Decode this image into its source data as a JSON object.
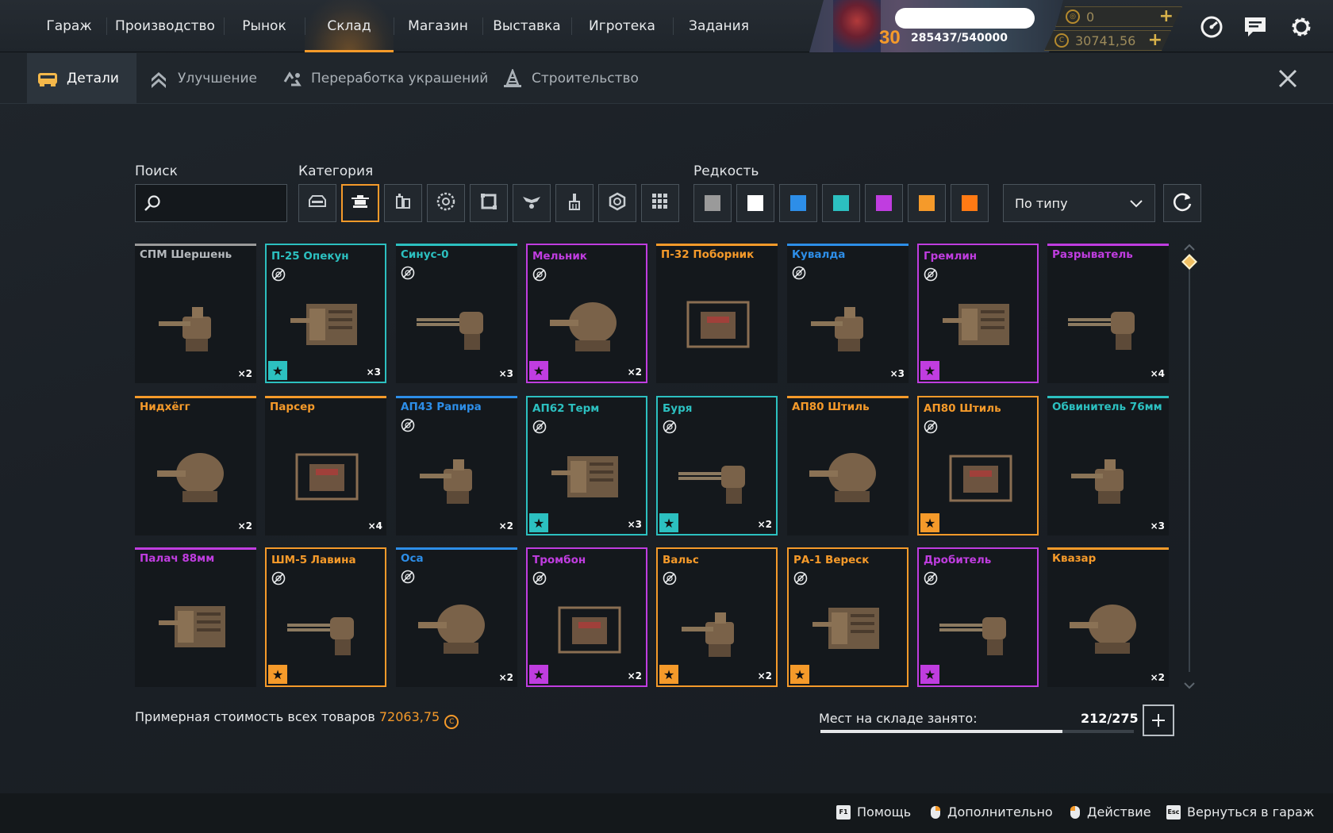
{
  "colors": {
    "accent": "#f59a2a",
    "rarity_common": "#9a9a9a",
    "rarity_rare": "#2d8ee8",
    "rarity_special": "#2cc0c0",
    "rarity_epic": "#c03de0",
    "rarity_legendary": "#f59a2a",
    "rarity_relic": "#ff7a14"
  },
  "nav": {
    "items": [
      "Гараж",
      "Производство",
      "Рынок",
      "Склад",
      "Магазин",
      "Выставка",
      "Игротека",
      "Задания"
    ],
    "active_index": 3
  },
  "profile": {
    "level": "30",
    "xp": "285437/540000",
    "currency_1": "0",
    "currency_2": "30741,56"
  },
  "top_icons": [
    "speedometer-icon",
    "chat-icon",
    "gear-icon"
  ],
  "subnav": {
    "items": [
      {
        "label": "Детали",
        "icon": "parts-icon"
      },
      {
        "label": "Улучшение",
        "icon": "upgrade-icon"
      },
      {
        "label": "Переработка украшений",
        "icon": "recycle-icon"
      },
      {
        "label": "Строительство",
        "icon": "construction-icon"
      }
    ],
    "active_index": 0
  },
  "filters": {
    "search_label": "Поиск",
    "search_value": "",
    "category_label": "Категория",
    "categories": [
      "cabin-icon",
      "weapon-icon",
      "module-icon",
      "wheel-icon",
      "frame-icon",
      "decor-icon",
      "paint-icon",
      "hexnut-icon",
      "all-grid-icon"
    ],
    "active_category": 1,
    "rarity_label": "Редкость",
    "rarities": [
      "#9a9a9a",
      "#ffffff",
      "#2d8ee8",
      "#2cc0c0",
      "#c03de0",
      "#f59a2a",
      "#ff7a14"
    ],
    "sort_value": "По типу"
  },
  "items": [
    {
      "name": "СПМ Шершень",
      "rarity": "common",
      "qty": "×2",
      "framed": false,
      "nosell": false,
      "star": false
    },
    {
      "name": "П-25 Опекун",
      "rarity": "special",
      "qty": "×3",
      "framed": true,
      "nosell": true,
      "star": true
    },
    {
      "name": "Синус-0",
      "rarity": "special",
      "qty": "×3",
      "framed": false,
      "nosell": true,
      "star": false
    },
    {
      "name": "Мельник",
      "rarity": "epic",
      "qty": "×2",
      "framed": true,
      "nosell": true,
      "star": true
    },
    {
      "name": "П-32 Поборник",
      "rarity": "legendary",
      "qty": "",
      "framed": false,
      "nosell": false,
      "star": false
    },
    {
      "name": "Кувалда",
      "rarity": "rare",
      "qty": "×3",
      "framed": false,
      "nosell": true,
      "star": false
    },
    {
      "name": "Гремлин",
      "rarity": "epic",
      "qty": "",
      "framed": true,
      "nosell": true,
      "star": true
    },
    {
      "name": "Разрыватель",
      "rarity": "epic",
      "qty": "×4",
      "framed": false,
      "nosell": false,
      "star": false
    },
    {
      "name": "Нидхёгг",
      "rarity": "legendary",
      "qty": "×2",
      "framed": false,
      "nosell": false,
      "star": false
    },
    {
      "name": "Парсер",
      "rarity": "legendary",
      "qty": "×4",
      "framed": false,
      "nosell": false,
      "star": false
    },
    {
      "name": "АП43 Рапира",
      "rarity": "rare",
      "qty": "×2",
      "framed": false,
      "nosell": true,
      "star": false
    },
    {
      "name": "АП62 Терм",
      "rarity": "special",
      "qty": "×3",
      "framed": true,
      "nosell": true,
      "star": true
    },
    {
      "name": "Буря",
      "rarity": "special",
      "qty": "×2",
      "framed": true,
      "nosell": true,
      "star": true
    },
    {
      "name": "АП80 Штиль",
      "rarity": "legendary",
      "qty": "",
      "framed": false,
      "nosell": false,
      "star": false
    },
    {
      "name": "АП80 Штиль",
      "rarity": "legendary",
      "qty": "",
      "framed": true,
      "nosell": true,
      "star": true
    },
    {
      "name": "Обвинитель 76мм",
      "rarity": "special",
      "qty": "×3",
      "framed": false,
      "nosell": false,
      "star": false
    },
    {
      "name": "Палач 88мм",
      "rarity": "epic",
      "qty": "",
      "framed": false,
      "nosell": false,
      "star": false
    },
    {
      "name": "ШМ-5 Лавина",
      "rarity": "legendary",
      "qty": "",
      "framed": true,
      "nosell": true,
      "star": true
    },
    {
      "name": "Оса",
      "rarity": "rare",
      "qty": "×2",
      "framed": false,
      "nosell": true,
      "star": false
    },
    {
      "name": "Тромбон",
      "rarity": "epic",
      "qty": "×2",
      "framed": true,
      "nosell": true,
      "star": true
    },
    {
      "name": "Вальс",
      "rarity": "legendary",
      "qty": "×2",
      "framed": true,
      "nosell": true,
      "star": true
    },
    {
      "name": "РА-1 Вереск",
      "rarity": "legendary",
      "qty": "",
      "framed": true,
      "nosell": true,
      "star": true
    },
    {
      "name": "Дробитель",
      "rarity": "epic",
      "qty": "",
      "framed": true,
      "nosell": true,
      "star": true
    },
    {
      "name": "Квазар",
      "rarity": "legendary",
      "qty": "×2",
      "framed": false,
      "nosell": false,
      "star": false
    }
  ],
  "footer": {
    "total_label": "Примерная стоимость всех товаров",
    "total_value": "72063,75",
    "storage_label": "Мест на складе занято:",
    "storage_value": "212/275",
    "storage_fraction": 0.771
  },
  "hints": [
    {
      "key": "F1",
      "label": "Помощь"
    },
    {
      "key": "mouse",
      "label": "Дополнительно"
    },
    {
      "key": "mouse",
      "label": "Действие"
    },
    {
      "key": "Esc",
      "label": "Вернуться в гараж"
    }
  ]
}
